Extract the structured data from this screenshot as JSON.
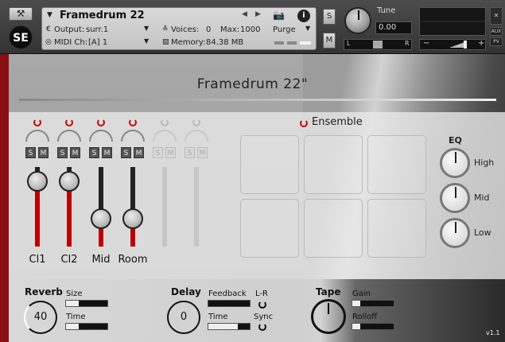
{
  "header": {
    "wrench_icon": "wrench-icon",
    "logo": "SE",
    "instrument_name": "Framedrum 22",
    "output_label": "Output:",
    "output_value": "surr.1",
    "midi_label": "MIDI Ch:",
    "midi_value": "[A] 1",
    "voices_label": "Voices:",
    "voices_value": "0",
    "max_label": "Max:",
    "max_value": "1000",
    "memory_label": "Memory:",
    "memory_value": "84.38 MB",
    "purge_label": "Purge",
    "solo_label": "S",
    "mute_label": "M",
    "tune_label": "Tune",
    "tune_value": "0.00",
    "pan_left": "L",
    "pan_right": "R",
    "aux_label": "AUX",
    "pv_label": "PV",
    "vol_minus": "−",
    "vol_plus": "+"
  },
  "page": {
    "title": "Framedrum 22\"",
    "version": "v1.1"
  },
  "mixer": {
    "solo": "S",
    "mute": "M",
    "channels": [
      {
        "label": "Cl1",
        "active": true,
        "level": 0.82
      },
      {
        "label": "Cl2",
        "active": true,
        "level": 0.82
      },
      {
        "label": "Mid",
        "active": true,
        "level": 0.35
      },
      {
        "label": "Room",
        "active": true,
        "level": 0.35
      },
      {
        "label": "",
        "active": false,
        "level": 0.0
      },
      {
        "label": "",
        "active": false,
        "level": 0.0
      }
    ]
  },
  "ensemble": {
    "label": "Ensemble",
    "pads": 6
  },
  "eq": {
    "label": "EQ",
    "bands": [
      "High",
      "Mid",
      "Low"
    ]
  },
  "effects": {
    "reverb": {
      "label": "Reverb",
      "value": "40",
      "size_label": "Size",
      "size": 0.3,
      "time_label": "Time",
      "time": 0.3
    },
    "delay": {
      "label": "Delay",
      "value": "0",
      "feedback_label": "Feedback",
      "feedback": 0.0,
      "time_label": "Time",
      "time": 0.72,
      "lr_label": "L-R",
      "sync_label": "Sync"
    },
    "tape": {
      "label": "Tape",
      "gain_label": "Gain",
      "gain": 0.2,
      "rolloff_label": "Rolloff",
      "rolloff": 0.2
    }
  }
}
